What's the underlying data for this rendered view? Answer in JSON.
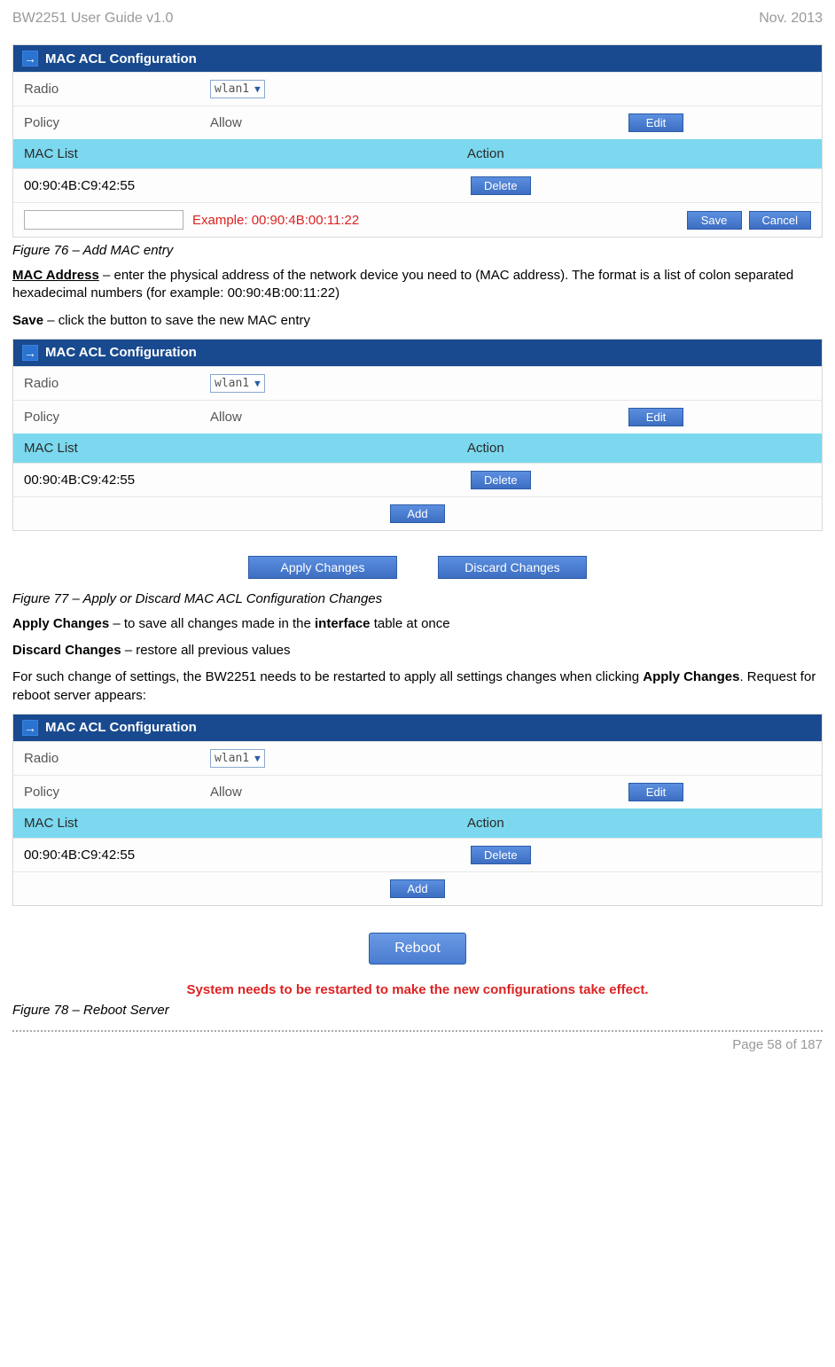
{
  "header": {
    "left": "BW2251 User Guide v1.0",
    "right": "Nov.  2013"
  },
  "footer": "Page 58 of 187",
  "panel1": {
    "title": "MAC ACL Configuration",
    "radio_label": "Radio",
    "radio_value": "wlan1",
    "policy_label": "Policy",
    "policy_value": "Allow",
    "edit_label": "Edit",
    "sub_mac": "MAC List",
    "sub_action": "Action",
    "mac1": "00:90:4B:C9:42:55",
    "delete_label": "Delete",
    "example": "Example: 00:90:4B:00:11:22",
    "save_label": "Save",
    "cancel_label": "Cancel"
  },
  "fig76": "Figure 76 – Add MAC entry",
  "txt_mac_bold": "MAC Address",
  "txt_mac_rest": " – enter the physical address of the network device you need to (MAC address). The format is a list of colon separated hexadecimal numbers (for example: 00:90:4B:00:11:22)",
  "txt_save_bold": "Save",
  "txt_save_rest": " – click the button to save the new MAC entry",
  "panel2": {
    "title": "MAC ACL Configuration",
    "radio_label": "Radio",
    "radio_value": "wlan1",
    "policy_label": "Policy",
    "policy_value": "Allow",
    "edit_label": "Edit",
    "sub_mac": "MAC List",
    "sub_action": "Action",
    "mac1": "00:90:4B:C9:42:55",
    "delete_label": "Delete",
    "add_label": "Add",
    "apply_label": "Apply Changes",
    "discard_label": "Discard Changes"
  },
  "fig77": "Figure 77 – Apply or Discard MAC ACL Configuration Changes",
  "txt_apply_bold": "Apply Changes",
  "txt_apply_mid": " – to save all changes made in the ",
  "txt_apply_bold2": "interface",
  "txt_apply_rest": " table at once",
  "txt_discard_bold": "Discard Changes",
  "txt_discard_rest": " – restore all previous values",
  "txt_reboot_1": "For such change of settings, the BW2251 needs to be restarted to apply all settings changes when clicking ",
  "txt_reboot_bold": "Apply Changes",
  "txt_reboot_2": ". Request for reboot server appears:",
  "panel3": {
    "title": "MAC ACL Configuration",
    "radio_label": "Radio",
    "radio_value": "wlan1",
    "policy_label": "Policy",
    "policy_value": "Allow",
    "edit_label": "Edit",
    "sub_mac": "MAC List",
    "sub_action": "Action",
    "mac1": "00:90:4B:C9:42:55",
    "delete_label": "Delete",
    "add_label": "Add",
    "reboot_label": "Reboot"
  },
  "system_msg": "System needs to be restarted to make the new configurations take effect.",
  "fig78": "Figure 78 – Reboot Server"
}
